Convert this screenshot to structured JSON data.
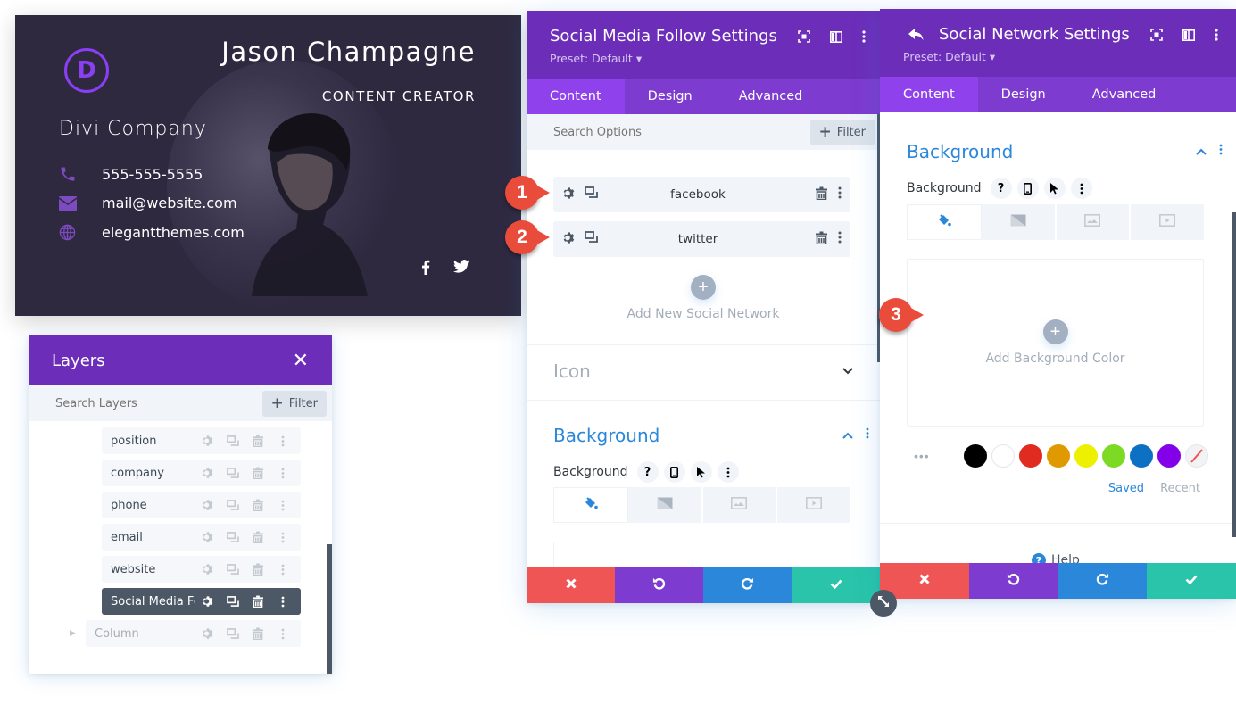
{
  "card": {
    "logo_letter": "D",
    "name": "Jason Champagne",
    "role": "CONTENT CREATOR",
    "company": "Divi Company",
    "contacts": [
      {
        "icon": "phone-icon",
        "text": "555-555-5555"
      },
      {
        "icon": "envelope-icon",
        "text": "mail@website.com"
      },
      {
        "icon": "globe-icon",
        "text": "elegantthemes.com"
      }
    ],
    "social_icons": [
      "facebook-icon",
      "twitter-icon"
    ],
    "accent_color": "#8a3ff5",
    "background_color": "#2f2940"
  },
  "layers": {
    "title": "Layers",
    "close_icon": "close-icon",
    "search_placeholder": "Search Layers",
    "filter_label": "Filter",
    "items": [
      {
        "label": "position",
        "state": "normal"
      },
      {
        "label": "company",
        "state": "normal"
      },
      {
        "label": "phone",
        "state": "normal"
      },
      {
        "label": "email",
        "state": "normal"
      },
      {
        "label": "website",
        "state": "normal"
      },
      {
        "label": "Social Media Foll...",
        "state": "active"
      },
      {
        "label": "Column",
        "state": "muted"
      }
    ]
  },
  "smf_modal": {
    "title": "Social Media Follow Settings",
    "preset": "Preset: Default",
    "tabs": [
      {
        "label": "Content",
        "active": true
      },
      {
        "label": "Design",
        "active": false
      },
      {
        "label": "Advanced",
        "active": false
      }
    ],
    "search_placeholder": "Search Options",
    "filter_label": "Filter",
    "networks": [
      {
        "label": "facebook",
        "badge": "1"
      },
      {
        "label": "twitter",
        "badge": "2"
      }
    ],
    "add_network_label": "Add New Social Network",
    "sections": {
      "icon_title": "Icon",
      "background_title": "Background",
      "background_label": "Background"
    }
  },
  "sn_modal": {
    "title": "Social Network Settings",
    "preset": "Preset: Default",
    "tabs": [
      {
        "label": "Content",
        "active": true
      },
      {
        "label": "Design",
        "active": false
      },
      {
        "label": "Advanced",
        "active": false
      }
    ],
    "section_title": "Background",
    "background_label": "Background",
    "add_color_label": "Add Background Color",
    "badge": "3",
    "swatches": [
      "#000000",
      "#ffffff",
      "#e02b20",
      "#e09900",
      "#edf000",
      "#7cda24",
      "#0c71c3",
      "#8300e9"
    ],
    "palette_tabs": {
      "saved": "Saved",
      "recent": "Recent"
    },
    "help_label": "Help"
  },
  "footer_colors": {
    "cancel": "#ef5555",
    "undo": "#7e3bd0",
    "redo": "#2b87da",
    "save": "#29c4a9"
  }
}
